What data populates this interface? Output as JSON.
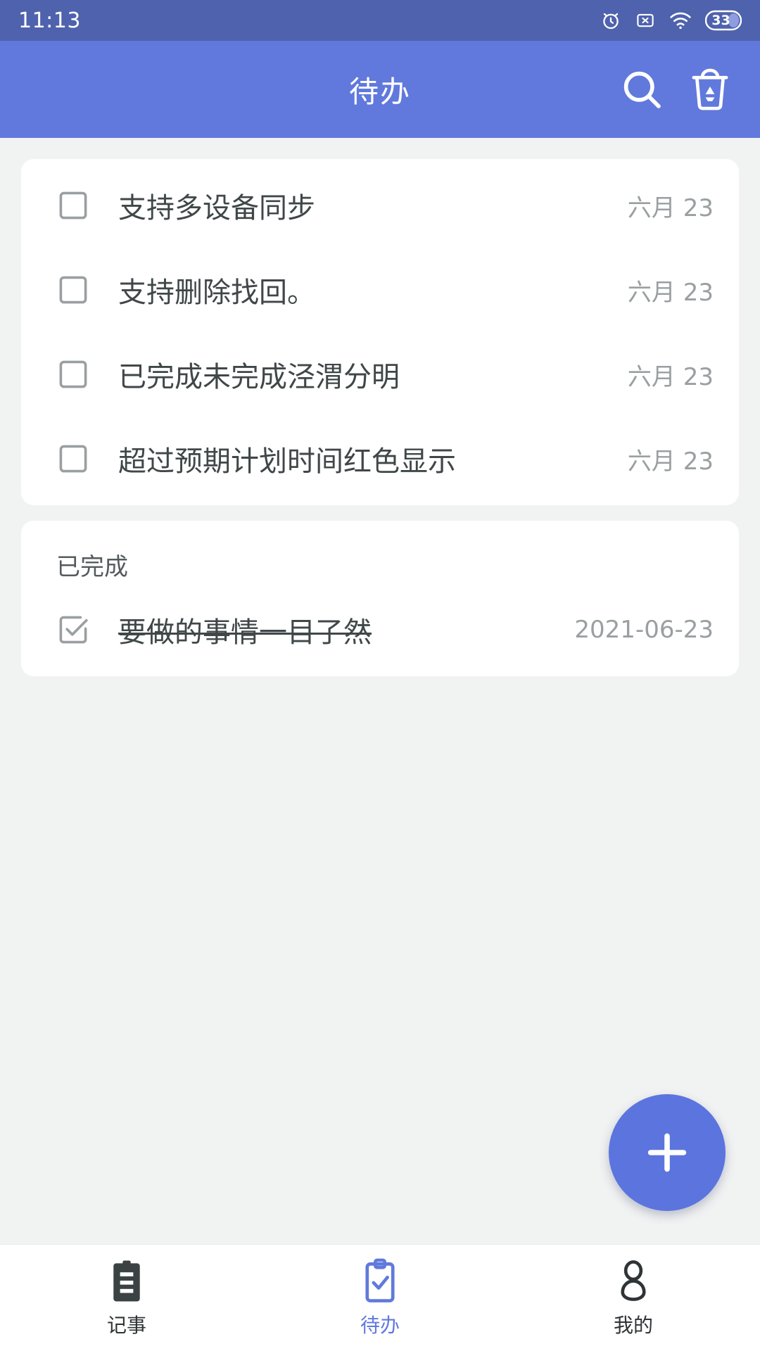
{
  "status_bar": {
    "time": "11:13",
    "battery_level": "33",
    "icons": [
      "alarm-icon",
      "no-sim-icon",
      "wifi-icon",
      "battery-icon"
    ]
  },
  "app_bar": {
    "title": "待办",
    "search_label": "search-icon",
    "trash_label": "recycle-bin-icon",
    "background_color": "#6179dc"
  },
  "todo_card": {
    "items": [
      {
        "title": "支持多设备同步",
        "date": "六月 23",
        "checked": false
      },
      {
        "title": "支持删除找回。",
        "date": "六月 23",
        "checked": false
      },
      {
        "title": "已完成未完成泾渭分明",
        "date": "六月 23",
        "checked": false
      },
      {
        "title": "超过预期计划时间红色显示",
        "date": "六月 23",
        "checked": false
      }
    ]
  },
  "done_card": {
    "section_title": "已完成",
    "items": [
      {
        "title": "要做的事情一目了然",
        "date": "2021-06-23",
        "checked": true
      }
    ]
  },
  "fab": {
    "label": "add-icon",
    "color": "#5b74de"
  },
  "bottom_nav": {
    "items": [
      {
        "label": "记事",
        "icon": "clipboard-notes-icon",
        "active": false
      },
      {
        "label": "待办",
        "icon": "clipboard-check-icon",
        "active": true
      },
      {
        "label": "我的",
        "icon": "person-icon",
        "active": false
      }
    ],
    "active_color": "#6179dc"
  }
}
